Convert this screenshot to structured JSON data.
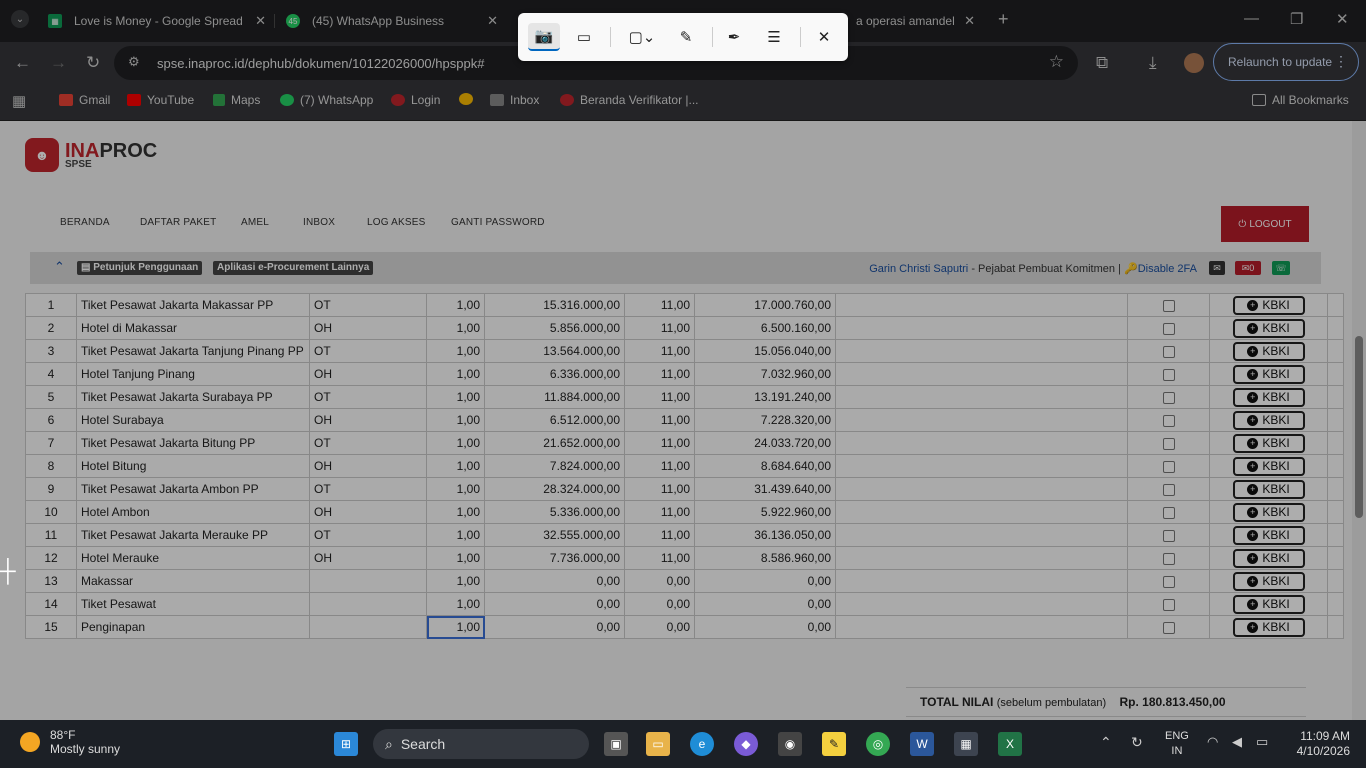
{
  "browser": {
    "tabs": [
      {
        "title": "Love is Money - Google Spread",
        "icon": "sheets-icon",
        "color": "#0f9d58"
      },
      {
        "title": "(45) WhatsApp Business",
        "icon": "whatsapp-icon",
        "color": "#25d366"
      },
      {
        "title": "a operasi amandel",
        "icon": "page-icon",
        "color": "#8ab4f8"
      }
    ],
    "url": "spse.inaproc.id/dephub/dokumen/10122026000/hpsppk#",
    "relaunch_label": "Relaunch to update",
    "bookmarks": [
      "Gmail",
      "YouTube",
      "Maps",
      "(7) WhatsApp",
      "Login",
      "",
      "Inbox",
      "Beranda Verifikator |..."
    ],
    "all_bookmarks": "All Bookmarks"
  },
  "site": {
    "logo_text_a": "INA",
    "logo_text_b": "PROC",
    "logo_sub": "SPSE",
    "nav": [
      "BERANDA",
      "DAFTAR PAKET",
      "AMEL",
      "INBOX",
      "LOG AKSES",
      "GANTI PASSWORD"
    ],
    "logout": "LOGOUT",
    "help_label": "Petunjuk Penggunaan",
    "apps_label": "Aplikasi e-Procurement Lainnya",
    "user_name": "Garin Christi Saputri",
    "user_role": " - Pejabat Pembuat Komitmen | ",
    "disable_2fa": "Disable 2FA",
    "inbox_count": "0"
  },
  "rows": [
    {
      "no": "1",
      "name": "Tiket Pesawat Jakarta Makassar PP",
      "unit": "OT",
      "qty": "1,00",
      "price": "15.316.000,00",
      "tax": "11,00",
      "total": "17.000.760,00",
      "btn": "KBKI"
    },
    {
      "no": "2",
      "name": "Hotel di Makassar",
      "unit": "OH",
      "qty": "1,00",
      "price": "5.856.000,00",
      "tax": "11,00",
      "total": "6.500.160,00",
      "btn": "KBKI"
    },
    {
      "no": "3",
      "name": "Tiket Pesawat Jakarta Tanjung Pinang PP",
      "unit": "OT",
      "qty": "1,00",
      "price": "13.564.000,00",
      "tax": "11,00",
      "total": "15.056.040,00",
      "btn": "KBKI"
    },
    {
      "no": "4",
      "name": "Hotel Tanjung Pinang",
      "unit": "OH",
      "qty": "1,00",
      "price": "6.336.000,00",
      "tax": "11,00",
      "total": "7.032.960,00",
      "btn": "KBKI"
    },
    {
      "no": "5",
      "name": "Tiket Pesawat Jakarta Surabaya PP",
      "unit": "OT",
      "qty": "1,00",
      "price": "11.884.000,00",
      "tax": "11,00",
      "total": "13.191.240,00",
      "btn": "KBKI"
    },
    {
      "no": "6",
      "name": "Hotel Surabaya",
      "unit": "OH",
      "qty": "1,00",
      "price": "6.512.000,00",
      "tax": "11,00",
      "total": "7.228.320,00",
      "btn": "KBKI"
    },
    {
      "no": "7",
      "name": "Tiket Pesawat Jakarta Bitung PP",
      "unit": "OT",
      "qty": "1,00",
      "price": "21.652.000,00",
      "tax": "11,00",
      "total": "24.033.720,00",
      "btn": "KBKI"
    },
    {
      "no": "8",
      "name": "Hotel Bitung",
      "unit": "OH",
      "qty": "1,00",
      "price": "7.824.000,00",
      "tax": "11,00",
      "total": "8.684.640,00",
      "btn": "KBKI"
    },
    {
      "no": "9",
      "name": "Tiket Pesawat Jakarta Ambon PP",
      "unit": "OT",
      "qty": "1,00",
      "price": "28.324.000,00",
      "tax": "11,00",
      "total": "31.439.640,00",
      "btn": "KBKI"
    },
    {
      "no": "10",
      "name": "Hotel Ambon",
      "unit": "OH",
      "qty": "1,00",
      "price": "5.336.000,00",
      "tax": "11,00",
      "total": "5.922.960,00",
      "btn": "KBKI"
    },
    {
      "no": "11",
      "name": "Tiket Pesawat Jakarta Merauke PP",
      "unit": "OT",
      "qty": "1,00",
      "price": "32.555.000,00",
      "tax": "11,00",
      "total": "36.136.050,00",
      "btn": "KBKI"
    },
    {
      "no": "12",
      "name": "Hotel Merauke",
      "unit": "OH",
      "qty": "1,00",
      "price": "7.736.000,00",
      "tax": "11,00",
      "total": "8.586.960,00",
      "btn": "KBKI"
    },
    {
      "no": "13",
      "name": "Makassar",
      "unit": "",
      "qty": "1,00",
      "price": "0,00",
      "tax": "0,00",
      "total": "0,00",
      "btn": "KBKI"
    },
    {
      "no": "14",
      "name": "Tiket Pesawat",
      "unit": "",
      "qty": "1,00",
      "price": "0,00",
      "tax": "0,00",
      "total": "0,00",
      "btn": "KBKI"
    },
    {
      "no": "15",
      "name": "Penginapan",
      "unit": "",
      "qty": "1,00",
      "price": "0,00",
      "tax": "0,00",
      "total": "0,00",
      "btn": "KBKI"
    }
  ],
  "total": {
    "label": "TOTAL NILAI",
    "note": "(sebelum pembulatan)",
    "value": "Rp. 180.813.450,00"
  },
  "taskbar": {
    "temp": "88°F",
    "weather": "Mostly sunny",
    "search": "Search",
    "lang1": "ENG",
    "lang2": "IN",
    "time": "11:09 AM",
    "date": "4/10/2026"
  }
}
